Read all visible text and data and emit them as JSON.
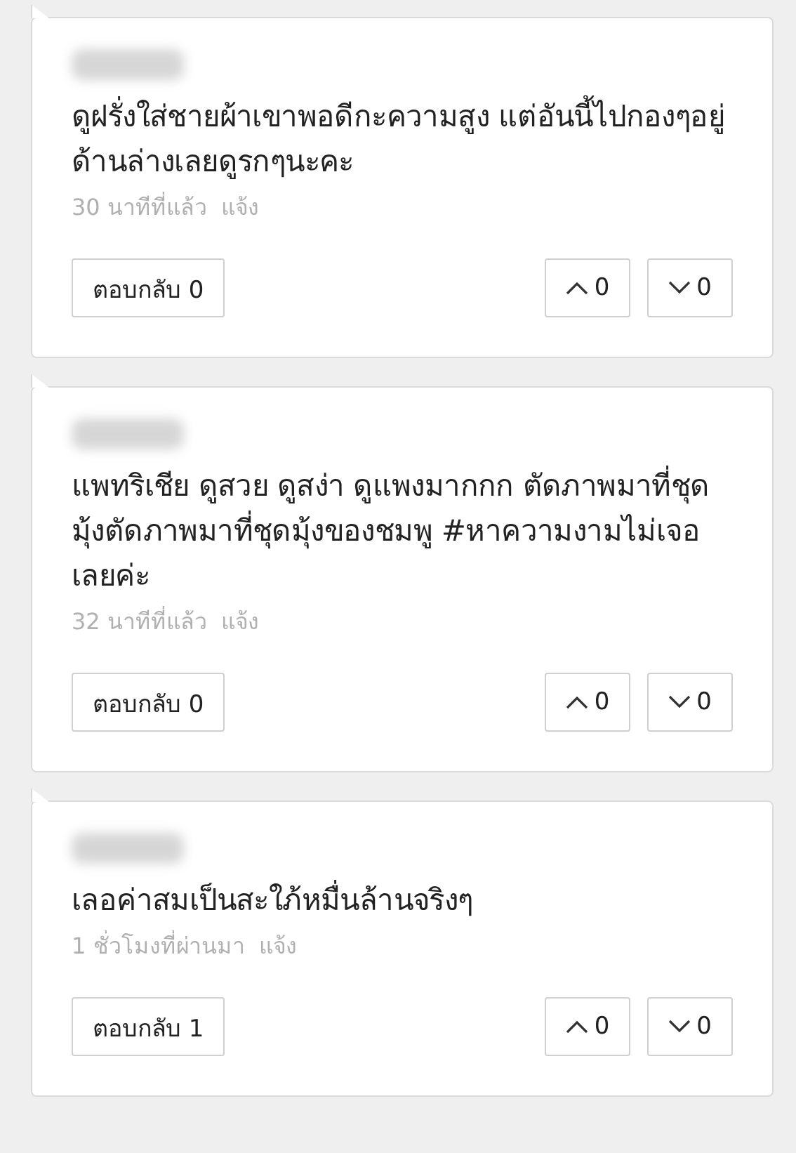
{
  "comments": [
    {
      "text": "ดูฝรั่งใส่ชายผ้าเขาพอดีกะความสูง แต่อันนี้ไปกองๆอยู่ด้านล่างเลยดูรกๆนะคะ",
      "time": "30 นาทีที่แล้ว",
      "report": "แจ้ง",
      "reply": "ตอบกลับ 0",
      "up": "0",
      "down": "0"
    },
    {
      "text": "แพทริเชีย ดูสวย ดูสง่า ดูแพงมากกก ตัดภาพมาที่ชุดมุ้งตัดภาพมาที่ชุดมุ้งของชมพู #หาความงามไม่เจอเลยค่ะ",
      "time": "32 นาทีที่แล้ว",
      "report": "แจ้ง",
      "reply": "ตอบกลับ 0",
      "up": "0",
      "down": "0"
    },
    {
      "text": "เลอค่าสมเป็นสะใภ้หมื่นล้านจริงๆ",
      "time": "1 ชั่วโมงที่ผ่านมา",
      "report": "แจ้ง",
      "reply": "ตอบกลับ 1",
      "up": "0",
      "down": "0"
    }
  ]
}
